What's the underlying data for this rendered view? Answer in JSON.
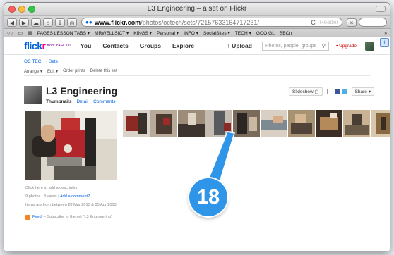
{
  "window": {
    "title": "L3 Engineering – a set on Flickr",
    "traffic_colors": [
      "#fc605c",
      "#fdbc40",
      "#34c84a"
    ]
  },
  "toolbar": {
    "back_label": "◀",
    "forward_label": "▶",
    "cloud_label": "☁",
    "home_label": "⌂",
    "share_label": "⇧",
    "options_label": "◎",
    "url_host": "www.flickr.com",
    "url_path": "/photos/octech/sets/72157633164717231/",
    "reload_label": "C",
    "reader_label": "Reader",
    "stop_label": "×"
  },
  "bookmarks": [
    {
      "label": "PAGES LESSON TABS ▾"
    },
    {
      "label": "MRWELLSICT ▾"
    },
    {
      "label": "KINGS ▾"
    },
    {
      "label": "Personal ▾"
    },
    {
      "label": "INFO ▾"
    },
    {
      "label": "SocialSites ▾"
    },
    {
      "label": "TECH ▾"
    },
    {
      "label": "GOO.GL"
    },
    {
      "label": "BBCn"
    }
  ],
  "bookmarks_more": "»",
  "flickr_nav": {
    "logo_blue": "flick",
    "logo_pink": "r",
    "yahoo": "from YAHOO!",
    "links": [
      "You",
      "Contacts",
      "Groups",
      "Explore"
    ],
    "upload": "↑ Upload",
    "search_placeholder": "Photos, people, groups",
    "upgrade": "• Upgrade"
  },
  "breadcrumb": {
    "text": "OC TECH · Sets"
  },
  "set_actions": [
    "Arrange ▾",
    "Edit ▾",
    "Order prints",
    "Delete this set"
  ],
  "set": {
    "title": "L3 Engineering",
    "tabs": [
      "Thumbnails",
      "Detail",
      "Comments"
    ],
    "slideshow": "Slideshow",
    "share": "Share ▾"
  },
  "sidebar": {
    "add_description": "Click here to add a description",
    "stats": "9 photos | 3 views |",
    "add_comment": "Add a comment?",
    "date_range": "Items are from between 28 Mar 2013 & 05 Apr 2013.",
    "feed": "Feed",
    "feed_desc": "– Subscribe to the set \"L3 Engineering\""
  },
  "callout": {
    "number": "18"
  },
  "thumbnails": [
    {
      "c1": "#8b2a24",
      "c2": "#d8d2c8"
    },
    {
      "c1": "#4a3a30",
      "c2": "#b7aa98"
    },
    {
      "c1": "#9d8c7a",
      "c2": "#3d3430"
    },
    {
      "c1": "#585a5e",
      "c2": "#c4bcb0"
    },
    {
      "c1": "#2a2624",
      "c2": "#7a6a5a"
    },
    {
      "c1": "#7d8a92",
      "c2": "#d9cfc2"
    },
    {
      "c1": "#a89274",
      "c2": "#514338"
    },
    {
      "c1": "#b58a5a",
      "c2": "#3a2e26"
    },
    {
      "c1": "#6a5a48",
      "c2": "#c9b394"
    },
    {
      "c1": "#8a6a42",
      "c2": "#d8c7ac"
    }
  ]
}
